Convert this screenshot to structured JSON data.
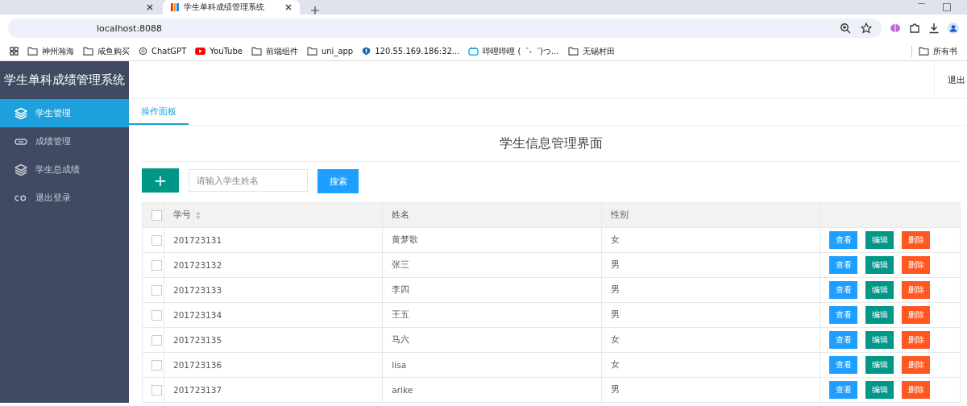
{
  "browser": {
    "tabs": [
      {
        "selected": false
      },
      {
        "title": "学生单科成绩管理系统",
        "selected": true
      }
    ],
    "address": "localhost:8088",
    "bookmarks": [
      {
        "label": "神州瀚海",
        "kind": "folder"
      },
      {
        "label": "咸鱼购买",
        "kind": "folder"
      },
      {
        "label": "ChatGPT",
        "kind": "chatgpt"
      },
      {
        "label": "YouTube",
        "kind": "youtube"
      },
      {
        "label": "前端组件",
        "kind": "folder"
      },
      {
        "label": "uni_app",
        "kind": "folder"
      },
      {
        "label": "120.55.169.186:32...",
        "kind": "site"
      },
      {
        "label": "哔哩哔哩 (゜-゜)つ...",
        "kind": "bilibili"
      },
      {
        "label": "无锡村田",
        "kind": "folder"
      }
    ],
    "all_bookmarks": "所有书"
  },
  "app": {
    "title": "学生单科成绩管理系统",
    "logout": "退出",
    "sidebar": [
      {
        "label": "学生管理",
        "selected": true
      },
      {
        "label": "成绩管理",
        "selected": false
      },
      {
        "label": "学生总成绩",
        "selected": false
      },
      {
        "label": "退出登录",
        "selected": false
      }
    ],
    "tabs": [
      {
        "label": "操作面板",
        "selected": true
      }
    ],
    "page_title": "学生信息管理界面",
    "add_button": "+",
    "search": {
      "placeholder": "请输入学生姓名"
    },
    "search_button": "搜索",
    "table": {
      "select_all": {
        "checked": false
      },
      "columns": [
        {
          "label": "学号",
          "sortable": true
        },
        {
          "label": "姓名",
          "sortable": false
        },
        {
          "label": "性别",
          "sortable": false
        }
      ],
      "rows": [
        {
          "checked": false,
          "id": "201723131",
          "name": "黄梦歌",
          "gender": "女",
          "actions": [
            {
              "label": "查看",
              "kind": "view"
            },
            {
              "label": "编辑",
              "kind": "edit"
            },
            {
              "label": "删除",
              "kind": "delete"
            }
          ]
        },
        {
          "checked": false,
          "id": "201723132",
          "name": "张三",
          "gender": "男",
          "actions": [
            {
              "label": "查看",
              "kind": "view"
            },
            {
              "label": "编辑",
              "kind": "edit"
            },
            {
              "label": "删除",
              "kind": "delete"
            }
          ]
        },
        {
          "checked": false,
          "id": "201723133",
          "name": "李四",
          "gender": "男",
          "actions": [
            {
              "label": "查看",
              "kind": "view"
            },
            {
              "label": "编辑",
              "kind": "edit"
            },
            {
              "label": "删除",
              "kind": "delete"
            }
          ]
        },
        {
          "checked": false,
          "id": "201723134",
          "name": "王五",
          "gender": "男",
          "actions": [
            {
              "label": "查看",
              "kind": "view"
            },
            {
              "label": "编辑",
              "kind": "edit"
            },
            {
              "label": "删除",
              "kind": "delete"
            }
          ]
        },
        {
          "checked": false,
          "id": "201723135",
          "name": "马六",
          "gender": "女",
          "actions": [
            {
              "label": "查看",
              "kind": "view"
            },
            {
              "label": "编辑",
              "kind": "edit"
            },
            {
              "label": "删除",
              "kind": "delete"
            }
          ]
        },
        {
          "checked": false,
          "id": "201723136",
          "name": "lisa",
          "gender": "女",
          "actions": [
            {
              "label": "查看",
              "kind": "view"
            },
            {
              "label": "编辑",
              "kind": "edit"
            },
            {
              "label": "删除",
              "kind": "delete"
            }
          ]
        },
        {
          "checked": false,
          "id": "201723137",
          "name": "arike",
          "gender": "男",
          "actions": [
            {
              "label": "查看",
              "kind": "view"
            },
            {
              "label": "编辑",
              "kind": "edit"
            },
            {
              "label": "删除",
              "kind": "delete"
            }
          ]
        }
      ]
    }
  }
}
